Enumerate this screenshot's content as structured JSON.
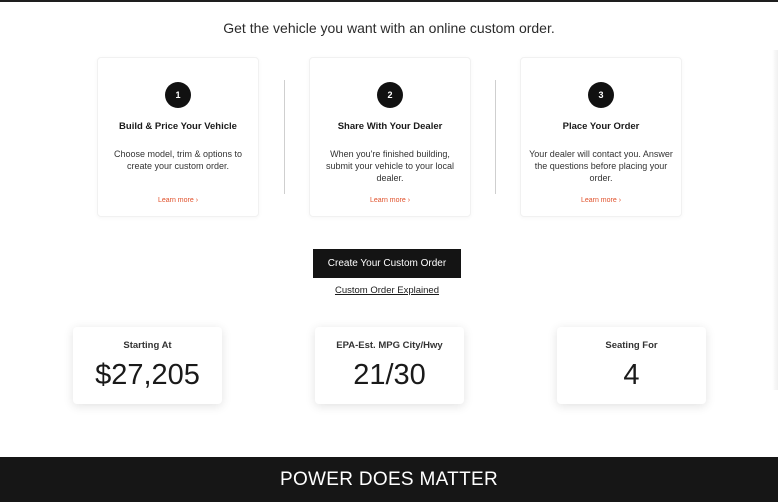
{
  "intro_text": "Get the vehicle you want with an online custom order.",
  "steps": [
    {
      "number": "1",
      "title": "Build & Price Your Vehicle",
      "description": "Choose model, trim & options to create your custom order.",
      "link": "Learn more ›"
    },
    {
      "number": "2",
      "title": "Share With Your Dealer",
      "description": "When you're finished building, submit your vehicle to your local dealer.",
      "link": "Learn more ›"
    },
    {
      "number": "3",
      "title": "Place Your Order",
      "description": "Your dealer will contact you. Answer the questions before placing your order.",
      "link": "Learn more ›"
    }
  ],
  "cta": {
    "button_label": "Create Your Custom Order",
    "link_label": "Custom Order Explained"
  },
  "stats": [
    {
      "label": "Starting At",
      "value": "$27,205"
    },
    {
      "label": "EPA-Est. MPG City/Hwy",
      "value": "21/30"
    },
    {
      "label": "Seating For",
      "value": "4"
    }
  ],
  "banner": {
    "title": "POWER DOES MATTER"
  },
  "colors": {
    "accent_link": "#e0502a",
    "dark": "#141414",
    "banner_bg": "#161616"
  }
}
